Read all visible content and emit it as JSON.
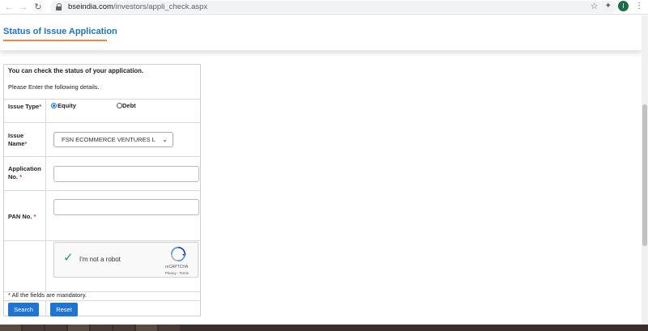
{
  "browser": {
    "url_host": "bseindia.com",
    "url_path": "/investors/appli_check.aspx"
  },
  "header": {
    "title": "Status of Issue Application"
  },
  "form": {
    "intro": "You can check the status of your application.",
    "instruction": "Please Enter the following details.",
    "issue_type": {
      "label": "Issue Type",
      "required": "*",
      "options": [
        "Equity",
        "Debt"
      ],
      "selected": "Equity"
    },
    "issue_name": {
      "label": "Issue Name",
      "required": "*",
      "selected": "FSN ECOMMERCE VENTURES L"
    },
    "application_no": {
      "label": "Application No.",
      "required": "*",
      "value": ""
    },
    "pan_no": {
      "label": "PAN No.",
      "required": "*",
      "value": ""
    },
    "captcha": {
      "label": "I'm not a robot",
      "brand": "reCAPTCHA",
      "links": "Privacy - Terms",
      "checked": true
    },
    "mandatory_note": "* All the fields are mandatory.",
    "search_label": "Search",
    "reset_label": "Reset"
  },
  "colors": {
    "title": "#1f75c4",
    "accent_underline": "#e98a3a",
    "button": "#1f75d1",
    "required": "#d13b3b"
  }
}
